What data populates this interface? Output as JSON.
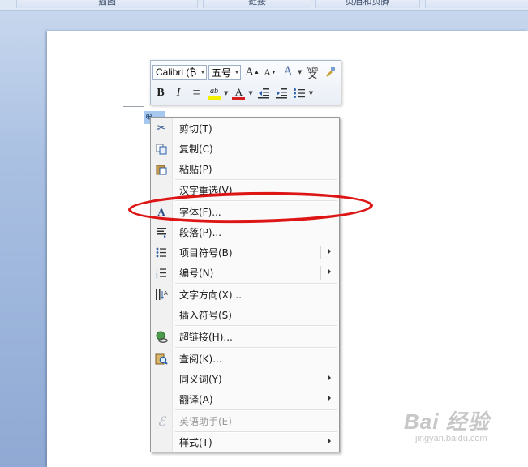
{
  "ribbon": {
    "tabs": [
      "插图",
      "链接",
      "页眉和页脚",
      ""
    ]
  },
  "mini_toolbar": {
    "font_name": "Calibri (₿",
    "font_size": "五号",
    "grow_font": "A",
    "shrink_font": "A",
    "font_effects": "A",
    "phonetic": "wén",
    "phonetic_sub": "文",
    "bold": "B",
    "italic": "I",
    "center": "≡",
    "highlight": "ab",
    "font_color": "A"
  },
  "context_menu": {
    "items": [
      {
        "label": "剪切(T)",
        "icon": "scissors-icon"
      },
      {
        "label": "复制(C)",
        "icon": "copy-icon"
      },
      {
        "label": "粘贴(P)",
        "icon": "paste-icon"
      },
      {
        "label": "汉字重选(V)",
        "icon": ""
      },
      {
        "label": "字体(F)...",
        "icon": "font-icon"
      },
      {
        "label": "段落(P)...",
        "icon": "paragraph-icon"
      },
      {
        "label": "项目符号(B)",
        "icon": "bullets-icon"
      },
      {
        "label": "编号(N)",
        "icon": "numbering-icon"
      },
      {
        "label": "文字方向(X)...",
        "icon": "text-direction-icon"
      },
      {
        "label": "插入符号(S)",
        "icon": ""
      },
      {
        "label": "超链接(H)...",
        "icon": "hyperlink-icon"
      },
      {
        "label": "查阅(K)...",
        "icon": "lookup-icon"
      },
      {
        "label": "同义词(Y)",
        "icon": ""
      },
      {
        "label": "翻译(A)",
        "icon": ""
      },
      {
        "label": "英语助手(E)",
        "icon": "english-assistant-icon"
      },
      {
        "label": "样式(T)",
        "icon": ""
      }
    ]
  },
  "watermark": {
    "main": "Bai 经验",
    "sub": "jingyan.baidu.com"
  },
  "colors": {
    "highlight_oval": "#dd1515",
    "selection": "#a6c8ee"
  }
}
